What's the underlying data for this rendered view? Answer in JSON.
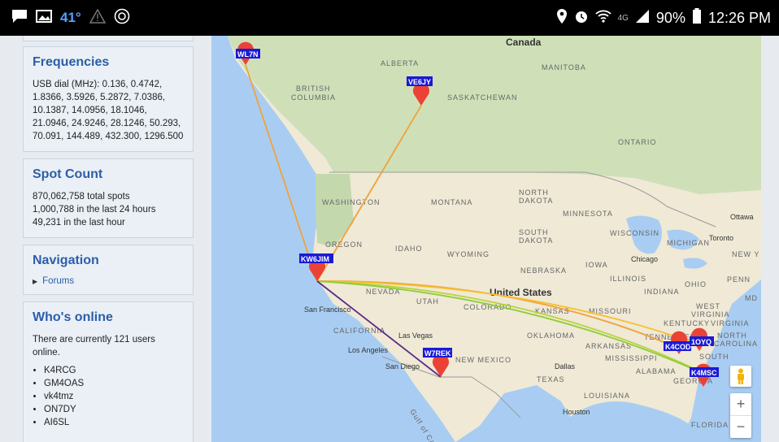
{
  "status_bar": {
    "temperature": "41°",
    "signal_label": "4G",
    "battery": "90%",
    "time": "12:26 PM"
  },
  "sidebar": {
    "frequencies": {
      "title": "Frequencies",
      "text": "USB dial (MHz): 0.136, 0.4742, 1.8366, 3.5926, 5.2872, 7.0386, 10.1387, 14.0956, 18.1046, 21.0946, 24.9246, 28.1246, 50.293, 70.091, 144.489, 432.300, 1296.500"
    },
    "spot_count": {
      "title": "Spot Count",
      "total": "870,062,758 total spots",
      "last_24h": "1,000,788 in the last 24 hours",
      "last_hour": "49,231 in the last hour"
    },
    "navigation": {
      "title": "Navigation",
      "link": "Forums"
    },
    "whos_online": {
      "title": "Who's online",
      "text": "There are currently 121 users online.",
      "users": [
        "K4RCG",
        "GM4OAS",
        "vk4tmz",
        "ON7DY",
        "AI6SL"
      ]
    }
  },
  "map": {
    "regions": {
      "canada": "Canada",
      "alberta": "ALBERTA",
      "manitoba": "MANITOBA",
      "british_columbia_1": "BRITISH",
      "british_columbia_2": "COLUMBIA",
      "saskatchewan": "SASKATCHEWAN",
      "ontario": "ONTARIO",
      "washington": "WASHINGTON",
      "montana": "MONTANA",
      "north_dakota_1": "NORTH",
      "north_dakota_2": "DAKOTA",
      "minnesota": "MINNESOTA",
      "south_dakota_1": "SOUTH",
      "south_dakota_2": "DAKOTA",
      "wisconsin": "WISCONSIN",
      "michigan": "MICHIGAN",
      "oregon": "OREGON",
      "idaho": "IDAHO",
      "wyoming": "WYOMING",
      "iowa": "IOWA",
      "nebraska": "NEBRASKA",
      "illinois": "ILLINOIS",
      "indiana": "INDIANA",
      "ohio": "OHIO",
      "penn": "PENN",
      "nevada": "NEVADA",
      "utah": "UTAH",
      "colorado": "COLORADO",
      "kansas": "KANSAS",
      "missouri": "MISSOURI",
      "west_virginia_1": "WEST",
      "west_virginia_2": "VIRGINIA",
      "kentucky": "KENTUCKY",
      "virginia": "VIRGINIA",
      "california": "CALIFORNIA",
      "oklahoma": "OKLAHOMA",
      "arkansas": "ARKANSAS",
      "tennessee": "TENNESSEE",
      "north_carolina_1": "NORTH",
      "north_carolina_2": "CAROLINA",
      "new_mexico": "NEW MEXICO",
      "mississippi": "MISSISSIPPI",
      "south_carolina": "SOUTH",
      "alabama": "ALABAMA",
      "georgia": "GEORGIA",
      "texas": "TEXAS",
      "louisiana": "LOUISIANA",
      "florida": "FLORIDA",
      "united_states": "United States",
      "gulf": "Gulf of Calif.",
      "new_york": "NEW Y",
      "md": "MD"
    },
    "cities": {
      "ottawa": "Ottawa",
      "toronto": "Toronto",
      "chicago": "Chicago",
      "san_francisco": "San Francisco",
      "las_vegas": "Las Vegas",
      "los_angeles": "Los Angeles",
      "san_diego": "San Diego",
      "dallas": "Dallas",
      "houston": "Houston"
    },
    "stations": {
      "wl7n": "WL7N",
      "ve6jy": "VE6JY",
      "kw6jim": "KW6JIM",
      "w7rek": "W7REK",
      "k4cod": "K4COD",
      "w1oyq": "1OYQ",
      "k4msc": "K4MSC"
    },
    "colors": {
      "water": "#a9cdf2",
      "land": "#efe9d6",
      "forest": "#cfe0b8",
      "marker": "#ea4335",
      "label_bg": "#1a1ad6"
    },
    "zoom_in": "+",
    "zoom_out": "−"
  }
}
